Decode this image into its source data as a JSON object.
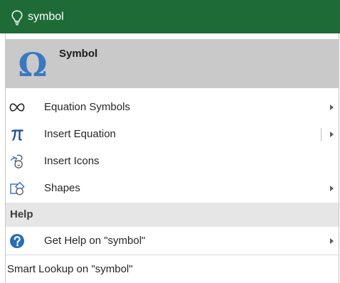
{
  "search": {
    "query": "symbol",
    "icon": "lightbulb-icon"
  },
  "top_result": {
    "title": "Symbol",
    "icon": "omega-icon",
    "icon_glyph": "Ω",
    "icon_color": "#3a78c2"
  },
  "items": [
    {
      "label": "Equation Symbols",
      "icon": "infinity-icon",
      "has_submenu": true
    },
    {
      "label": "Insert Equation",
      "icon": "pi-icon",
      "has_submenu": true,
      "split": true
    },
    {
      "label": "Insert Icons",
      "icon": "insert-icons-icon",
      "has_submenu": false
    },
    {
      "label": "Shapes",
      "icon": "shapes-icon",
      "has_submenu": true
    }
  ],
  "help_section": {
    "header": "Help",
    "item": {
      "label": "Get Help on \"symbol\"",
      "icon": "help-circle-icon",
      "has_submenu": true
    }
  },
  "smart_lookup": {
    "label": "Smart Lookup on \"symbol\""
  },
  "colors": {
    "search_bar": "#1e6b37",
    "top_result_bg": "#c9c9c9",
    "section_bg": "#e6e6e6",
    "accent_blue": "#2a6db5"
  }
}
